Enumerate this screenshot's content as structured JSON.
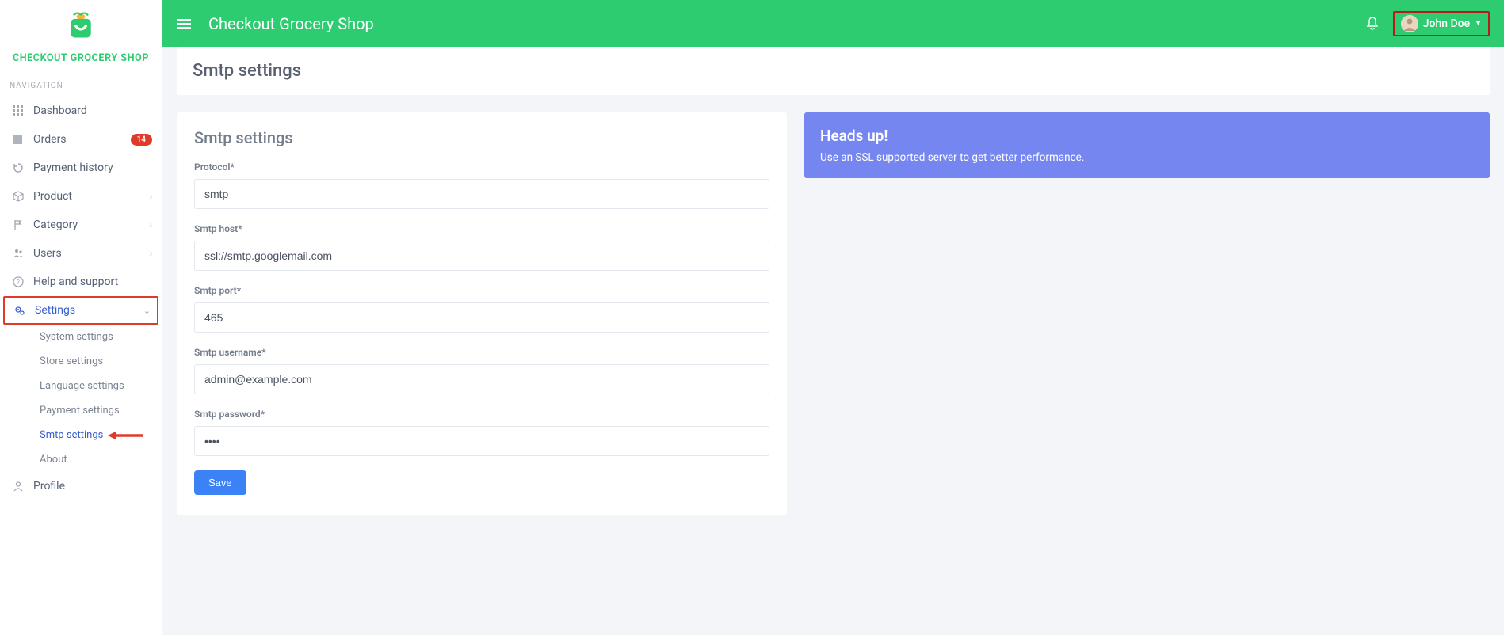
{
  "brand": "CHECKOUT GROCERY SHOP",
  "nav_header": "NAVIGATION",
  "sidebar": {
    "dashboard": "Dashboard",
    "orders": "Orders",
    "orders_badge": "14",
    "payment_history": "Payment history",
    "product": "Product",
    "category": "Category",
    "users": "Users",
    "help": "Help and support",
    "settings": "Settings",
    "profile": "Profile",
    "sub": {
      "system": "System settings",
      "store": "Store settings",
      "language": "Language settings",
      "payment": "Payment settings",
      "smtp": "Smtp settings",
      "about": "About"
    }
  },
  "topbar": {
    "title": "Checkout Grocery Shop",
    "user": "John Doe"
  },
  "page_title": "Smtp settings",
  "form": {
    "title": "Smtp settings",
    "protocol_label": "Protocol*",
    "protocol_value": "smtp",
    "host_label": "Smtp host*",
    "host_value": "ssl://smtp.googlemail.com",
    "port_label": "Smtp port*",
    "port_value": "465",
    "user_label": "Smtp username*",
    "user_value": "admin@example.com",
    "pass_label": "Smtp password*",
    "pass_value": "••••",
    "save": "Save"
  },
  "alert": {
    "title": "Heads up!",
    "text": "Use an SSL supported server to get better performance."
  }
}
